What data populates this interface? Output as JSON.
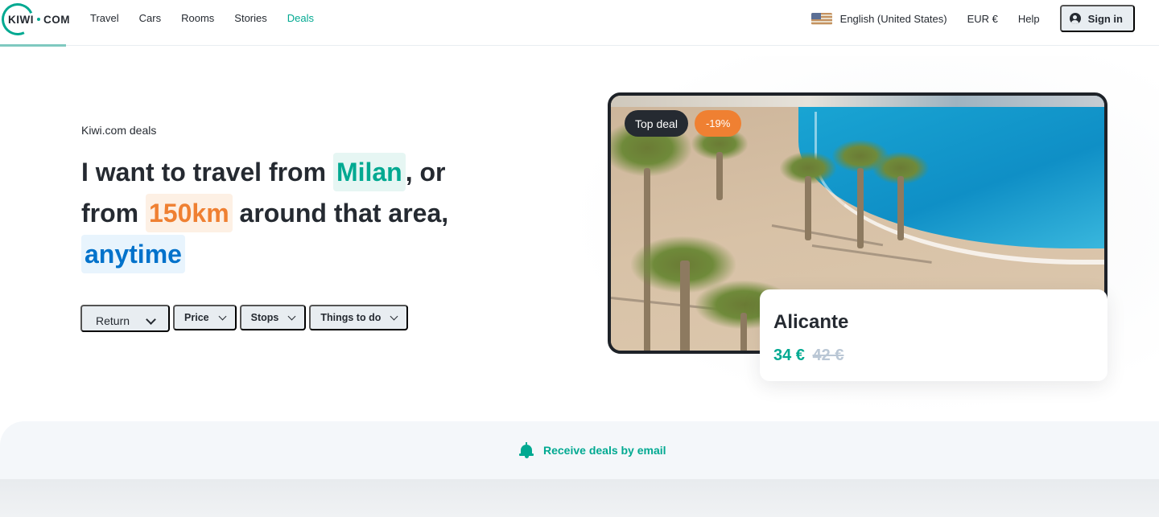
{
  "header": {
    "logo": {
      "left": "KIWI",
      "right": "COM"
    },
    "nav": [
      {
        "label": "Travel",
        "active": false
      },
      {
        "label": "Cars",
        "active": false
      },
      {
        "label": "Rooms",
        "active": false
      },
      {
        "label": "Stories",
        "active": false
      },
      {
        "label": "Deals",
        "active": true
      }
    ],
    "language": {
      "icon": "us-flag-icon",
      "label": "English (United States)"
    },
    "currency": "EUR €",
    "help": "Help",
    "signin": {
      "icon": "user-icon",
      "label": "Sign in"
    }
  },
  "hero": {
    "eyebrow": "Kiwi.com deals",
    "headline": {
      "part1": "I want to travel from",
      "origin": "Milan",
      "part2": ", or from",
      "radius": "150km",
      "part3": "around that area,",
      "time": "anytime"
    },
    "filters": [
      {
        "label": "Return",
        "icon": "chevron-down-icon"
      },
      {
        "label": "Price",
        "icon": "chevron-down-icon"
      },
      {
        "label": "Stops",
        "icon": "chevron-down-icon"
      },
      {
        "label": "Things to do",
        "icon": "chevron-down-icon"
      }
    ]
  },
  "featured_deal": {
    "badges": {
      "top": "Top deal",
      "discount": "-19%"
    },
    "city": "Alicante",
    "price": "34 €",
    "old_price": "42 €",
    "colors": {
      "price": "#00a991",
      "discount": "#ef8032"
    }
  },
  "email_strip": {
    "icon": "bell-icon",
    "label": "Receive deals by email"
  },
  "colors": {
    "brand": "#00a991",
    "text": "#252a31",
    "highlight_orange": "#ef8032",
    "highlight_blue": "#0172cb"
  }
}
